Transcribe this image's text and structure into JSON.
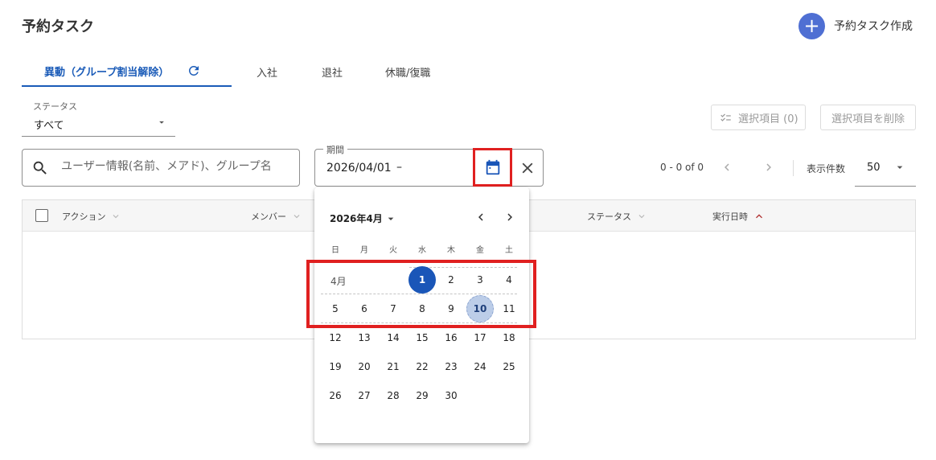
{
  "page": {
    "title": "予約タスク",
    "create_label": "予約タスク作成"
  },
  "tabs": [
    {
      "label": "異動（グループ割当解除）"
    },
    {
      "label": "入社"
    },
    {
      "label": "退社"
    },
    {
      "label": "休職/復職"
    }
  ],
  "filters": {
    "status_label": "ステータス",
    "status_value": "すべて",
    "selected_items_label": "選択項目 (0)",
    "delete_selected_label": "選択項目を削除",
    "search_placeholder": "ユーザー情報(名前、メアド)、グループ名",
    "period_label": "期間",
    "period_value": "2026/04/01",
    "period_dash": "–"
  },
  "pagination": {
    "range": "0 - 0 of 0",
    "page_size_label": "表示件数",
    "page_size": "50"
  },
  "table": {
    "columns": {
      "action": "アクション",
      "member": "メンバー",
      "status": "ステータス",
      "exec_time": "実行日時"
    }
  },
  "calendar": {
    "month_title": "2026年4月",
    "month_label": "4月",
    "weekdays": [
      "日",
      "月",
      "火",
      "水",
      "木",
      "金",
      "土"
    ],
    "weeks": [
      [
        "",
        "",
        "",
        "1",
        "2",
        "3",
        "4"
      ],
      [
        "5",
        "6",
        "7",
        "8",
        "9",
        "10",
        "11"
      ],
      [
        "12",
        "13",
        "14",
        "15",
        "16",
        "17",
        "18"
      ],
      [
        "19",
        "20",
        "21",
        "22",
        "23",
        "24",
        "25"
      ],
      [
        "26",
        "27",
        "28",
        "29",
        "30",
        "",
        ""
      ]
    ],
    "selected_day": "1",
    "range_end_day": "10"
  },
  "colors": {
    "primary": "#1a56b8",
    "create_button": "#4f6fd3",
    "highlight": "#e02020",
    "sort_arrow": "#b03030"
  },
  "icons": {
    "create": "plus-icon",
    "refresh": "refresh-icon",
    "status_caret": "caret-down-icon",
    "selected_items": "checklist-icon",
    "search": "search-icon",
    "calendar": "calendar-icon",
    "clear": "close-icon",
    "prev_page": "chevron-left-icon",
    "next_page": "chevron-right-icon",
    "sort_asc": "chevron-up-icon",
    "sort": "chevron-down-icon"
  }
}
